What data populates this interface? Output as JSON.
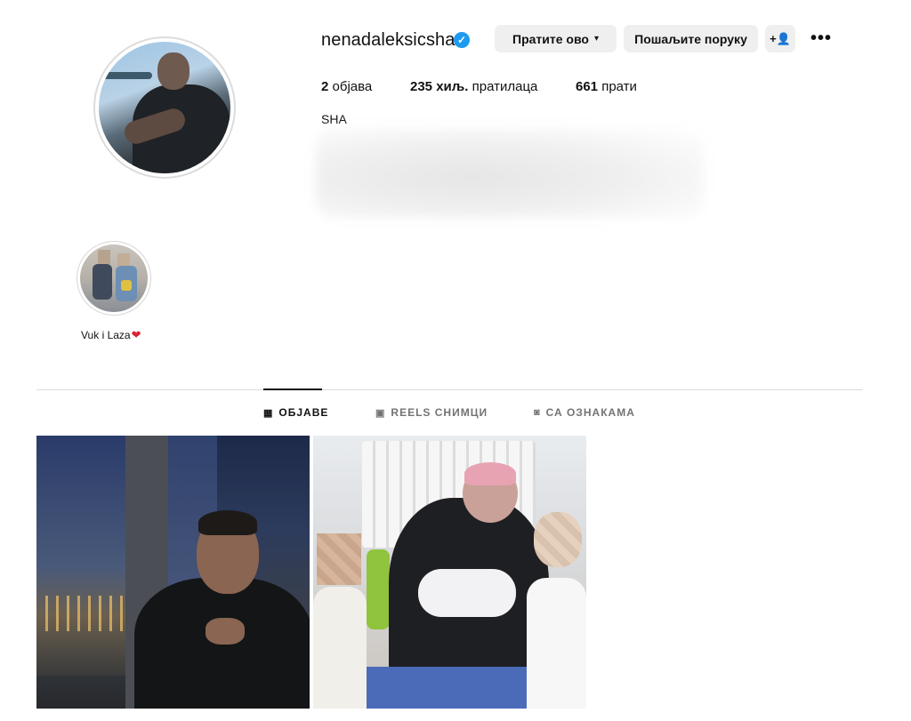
{
  "profile": {
    "username": "nenadaleksicsha",
    "verified_glyph": "✓",
    "follow_button": "Пратите ово",
    "message_button": "Пошаљите поруку",
    "suggest_icon": "+👤",
    "more_icon": "•••",
    "stats": {
      "posts_count": "2",
      "posts_label": "објава",
      "followers_count": "235 хиљ.",
      "followers_label": "пратилаца",
      "following_count": "661",
      "following_label": "прати"
    },
    "bio_name": "SHA"
  },
  "highlights": [
    {
      "label": "Vuk i Laza",
      "emoji": "❤"
    }
  ],
  "tabs": [
    {
      "label": "ОБЈАВЕ",
      "icon": "▦",
      "active": true
    },
    {
      "label": "REELS СНИМЦИ",
      "icon": "▣",
      "active": false
    },
    {
      "label": "СА ОЗНАКАМА",
      "icon": "◙",
      "active": false
    }
  ],
  "colors": {
    "verified": "#1d9bf0",
    "button_bg": "#efefef",
    "inactive_tab": "#737373",
    "heart": "#d92232"
  }
}
